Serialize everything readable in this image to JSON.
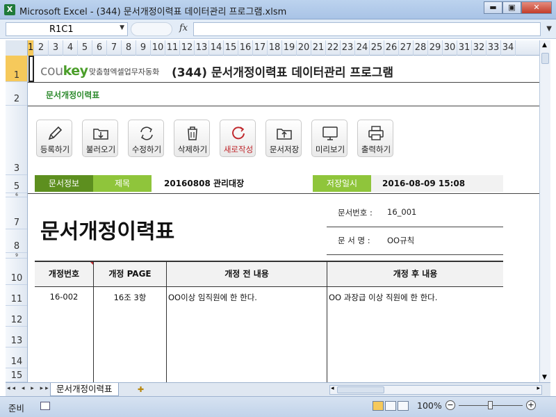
{
  "window": {
    "title": "Microsoft Excel - (344) 문서개정이력표 데이터관리 프로그램.xlsm",
    "app_icon": "X",
    "minimize": "▬",
    "restore": "▣",
    "close": "✕"
  },
  "formula_bar": {
    "name_box": "R1C1",
    "fx": "fx",
    "formula": ""
  },
  "columns": [
    "1",
    "2",
    "3",
    "4",
    "5",
    "6",
    "7",
    "8",
    "9",
    "10",
    "11",
    "12",
    "13",
    "14",
    "15",
    "16",
    "17",
    "18",
    "19",
    "20",
    "21",
    "22",
    "23",
    "24",
    "25",
    "26",
    "27",
    "28",
    "29",
    "30",
    "31",
    "32",
    "33",
    "34"
  ],
  "rows": [
    "1",
    "2",
    "3",
    "5",
    "6",
    "7",
    "8",
    "9",
    "10",
    "11",
    "12",
    "13",
    "14",
    "15"
  ],
  "sheet": {
    "logo_prefix": "cou",
    "logo_key": "key",
    "slogan": "맞춤형엑셀업무자동화",
    "header_title": "(344) 문서개정이력표 데이터관리 프로그램",
    "subtitle": "문서개정이력표"
  },
  "toolbar": [
    {
      "label": "등록하기",
      "icon": "pencil-icon"
    },
    {
      "label": "불러오기",
      "icon": "download-icon"
    },
    {
      "label": "수정하기",
      "icon": "refresh-icon"
    },
    {
      "label": "삭제하기",
      "icon": "trash-icon"
    },
    {
      "label": "새로작성",
      "icon": "new-icon"
    },
    {
      "label": "문서저장",
      "icon": "folder-upload-icon"
    },
    {
      "label": "미리보기",
      "icon": "monitor-icon"
    },
    {
      "label": "출력하기",
      "icon": "printer-icon"
    }
  ],
  "info": {
    "doc_info_label": "문서정보",
    "subject_label": "제목",
    "subject_value": "20160808 관리대장",
    "saved_label": "저장일시",
    "saved_value": "2016-08-09 15:08"
  },
  "document": {
    "title": "문서개정이력표",
    "doc_no_label": "문서번호 :",
    "doc_no_value": "16_001",
    "doc_name_label": "문 서 명 :",
    "doc_name_value": "OO규칙"
  },
  "table": {
    "headers": [
      "개정번호",
      "개정 PAGE",
      "개정 전 내용",
      "개정 후 내용"
    ],
    "rows": [
      [
        "16-002",
        "16조 3항",
        "OO이상 임직원에 한 한다.",
        "OO 과장급 이상 직원에 한 한다."
      ]
    ]
  },
  "tabs": {
    "nav": "◂◂ ◂ ▸ ▸▸",
    "active": "문서개정이력표"
  },
  "status": {
    "ready": "준비",
    "zoom": "100%"
  },
  "colors": {
    "accent_green_dark": "#5d8f1f",
    "accent_green_light": "#8fc53b",
    "selection_yellow": "#f6c95b",
    "new_doc_red": "#c0282d"
  }
}
